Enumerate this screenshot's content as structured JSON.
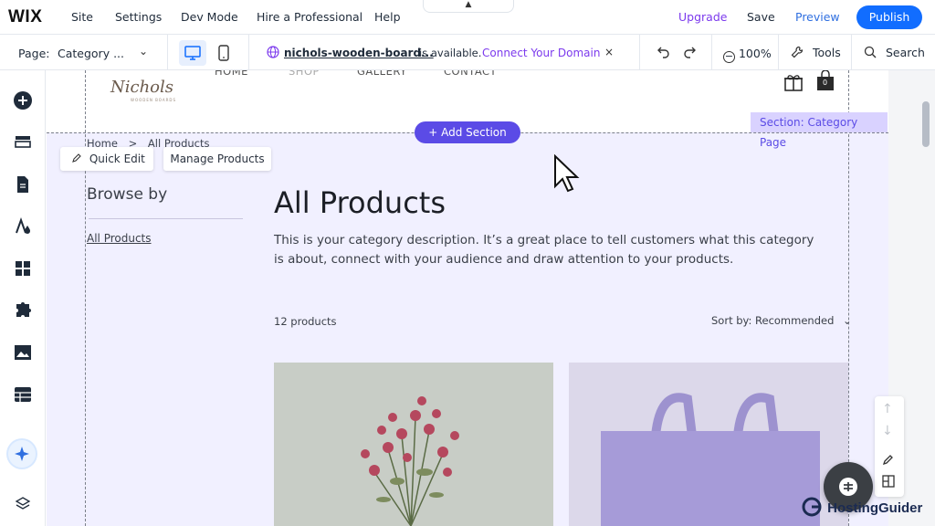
{
  "app": {
    "logo": "WIX"
  },
  "top_menu": [
    "Site",
    "Settings",
    "Dev Mode",
    "Hire a Professional",
    "Help"
  ],
  "top_right": {
    "upgrade": "Upgrade",
    "save": "Save",
    "preview": "Preview",
    "publish": "Publish"
  },
  "second_bar": {
    "page_label": "Page:",
    "page_value": "Category ...",
    "domain": "nichols-wooden-board...",
    "availability": "is available.",
    "connect": "Connect Your Domain",
    "close": "×",
    "zoom": "100%",
    "tools": "Tools",
    "search": "Search"
  },
  "site": {
    "brand": "Nichols",
    "brand_sub": "WOODEN BOARDS",
    "nav": [
      "HOME",
      "SHOP",
      "GALLERY",
      "CONTACT"
    ],
    "cart_count": "0",
    "add_section": "+ Add Section",
    "section_label": "Section: Category Page",
    "breadcrumb": {
      "home": "Home",
      "sep": ">",
      "current": "All Products"
    },
    "quick_edit": "Quick Edit",
    "manage_products": "Manage Products",
    "browse_by": "Browse by",
    "browse_link": "All Products",
    "heading": "All Products",
    "description": "This is your category description. It’s a great place to tell customers what this category is about, connect with your audience and draw attention to your products.",
    "product_count": "12 products",
    "sort": "Sort by: Recommended"
  },
  "watermark": "HostingGuider",
  "colors": {
    "accent": "#116dff",
    "purple": "#5b4be6",
    "section_bg": "#f1f0ff"
  }
}
